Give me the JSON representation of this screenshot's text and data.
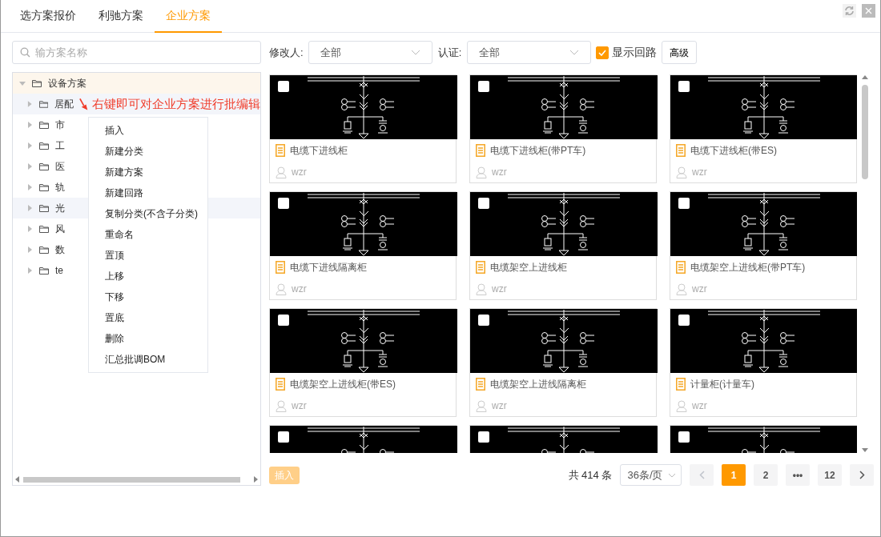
{
  "tabs": [
    {
      "label": "选方案报价",
      "selected": false
    },
    {
      "label": "利驰方案",
      "selected": false
    },
    {
      "label": "企业方案",
      "selected": true
    }
  ],
  "search": {
    "placeholder": "输方案名称"
  },
  "tree": {
    "items": [
      {
        "label": "设备方案",
        "expanded": true,
        "selected": true,
        "children": [
          {
            "label": "居配",
            "expanded": false,
            "selected": false,
            "highlighted": true,
            "annotation": "右键即可对企业方案进行批编辑"
          },
          {
            "label": "市",
            "expanded": false,
            "selected": false,
            "highlighted": false
          },
          {
            "label": "工",
            "expanded": false,
            "selected": false,
            "highlighted": false
          },
          {
            "label": "医",
            "expanded": false,
            "selected": false,
            "highlighted": false
          },
          {
            "label": "轨",
            "expanded": false,
            "selected": false,
            "highlighted": false
          },
          {
            "label": "光",
            "expanded": false,
            "selected": false,
            "highlighted": true
          },
          {
            "label": "风",
            "expanded": false,
            "selected": false,
            "highlighted": false
          },
          {
            "label": "数",
            "expanded": false,
            "selected": false,
            "highlighted": false
          },
          {
            "label": "te",
            "expanded": false,
            "selected": false,
            "highlighted": false
          }
        ]
      }
    ]
  },
  "context_menu": {
    "items": [
      "插入",
      "新建分类",
      "新建方案",
      "新建回路",
      "复制分类(不含子分类)",
      "重命名",
      "置顶",
      "上移",
      "下移",
      "置底",
      "删除",
      "汇总批调BOM"
    ]
  },
  "filters": {
    "modifier": {
      "label": "修改人:",
      "value": "全部"
    },
    "certification": {
      "label": "认证:",
      "value": "全部"
    },
    "show_circuit": {
      "label": "显示回路",
      "checked": true
    },
    "advanced_button": "高级"
  },
  "cards": [
    {
      "title": "电缆下进线柜",
      "author": "wzr",
      "checked": false
    },
    {
      "title": "电缆下进线柜(带PT车)",
      "author": "wzr",
      "checked": false
    },
    {
      "title": "电缆下进线柜(带ES)",
      "author": "wzr",
      "checked": false
    },
    {
      "title": "电缆下进线隔离柜",
      "author": "wzr",
      "checked": false
    },
    {
      "title": "电缆架空上进线柜",
      "author": "wzr",
      "checked": false
    },
    {
      "title": "电缆架空上进线柜(带PT车)",
      "author": "wzr",
      "checked": false
    },
    {
      "title": "电缆架空上进线柜(带ES)",
      "author": "wzr",
      "checked": false
    },
    {
      "title": "电缆架空上进线隔离柜",
      "author": "wzr",
      "checked": false
    },
    {
      "title": "计量柜(计量车)",
      "author": "wzr",
      "checked": false
    },
    {
      "checked": false
    },
    {
      "checked": false
    },
    {
      "checked": false
    }
  ],
  "footer": {
    "insert_button": "插入",
    "total": "共 414 条",
    "page_size": "36条/页",
    "prev_disabled": true,
    "pages": [
      {
        "label": "1",
        "selected": true
      },
      {
        "label": "2",
        "selected": false
      },
      {
        "label": "•••",
        "selected": false
      },
      {
        "label": "12",
        "selected": false
      }
    ]
  }
}
